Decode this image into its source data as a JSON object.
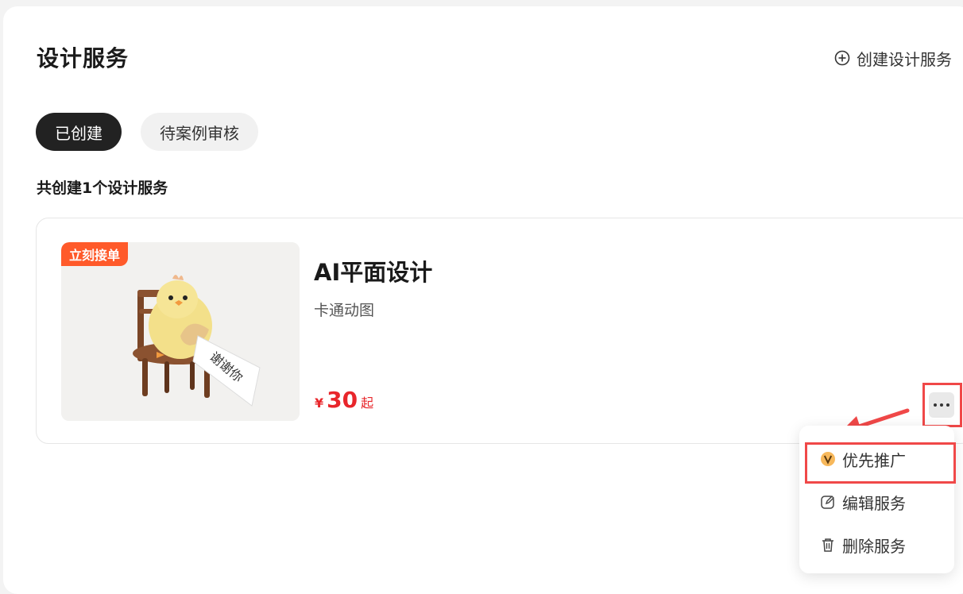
{
  "header": {
    "title": "设计服务",
    "create_label": "创建设计服务"
  },
  "tabs": [
    {
      "label": "已创建",
      "active": true
    },
    {
      "label": "待案例审核",
      "active": false
    }
  ],
  "summary": "共创建1个设计服务",
  "service": {
    "badge": "立刻接单",
    "title": "AI平面设计",
    "subtitle": "卡通动图",
    "price_currency": "¥",
    "price_value": "30",
    "price_unit": "起",
    "image_text": "谢谢你"
  },
  "menu": {
    "items": [
      {
        "label": "优先推广",
        "icon": "vip-badge-icon"
      },
      {
        "label": "编辑服务",
        "icon": "edit-icon"
      },
      {
        "label": "删除服务",
        "icon": "trash-icon"
      }
    ]
  },
  "colors": {
    "accent_price": "#e8262b",
    "badge": "#ff5a2a",
    "highlight": "#f04848",
    "tab_active": "#222222"
  }
}
